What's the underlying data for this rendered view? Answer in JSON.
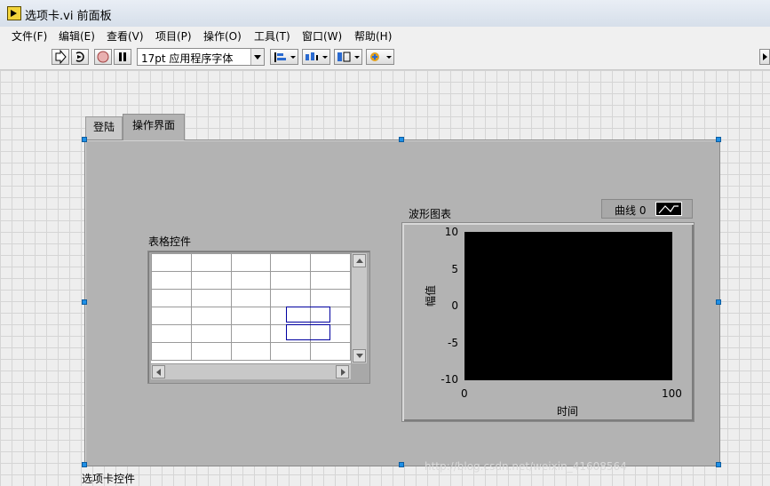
{
  "window": {
    "title": "选项卡.vi 前面板"
  },
  "menu": [
    "文件(F)",
    "编辑(E)",
    "查看(V)",
    "项目(P)",
    "操作(O)",
    "工具(T)",
    "窗口(W)",
    "帮助(H)"
  ],
  "toolbar": {
    "icons": [
      "run-arrow-icon",
      "run-continuously-icon",
      "abort-icon",
      "pause-icon",
      "align-objects-icon",
      "distribute-objects-icon",
      "resize-objects-icon",
      "reorder-icon"
    ],
    "font": "17pt 应用程序字体"
  },
  "tab_control": {
    "label": "选项卡控件",
    "tabs": [
      "登陆",
      "操作界面"
    ],
    "active_tab": "操作界面"
  },
  "table": {
    "label": "表格控件",
    "rows": 6,
    "columns": 5
  },
  "chart": {
    "label": "波形图表",
    "legend_label": "曲线 0",
    "xlabel": "时间",
    "ylabel": "幅值",
    "yticks": [
      "10",
      "5",
      "0",
      "-5",
      "-10"
    ],
    "xticks": [
      "0",
      "100"
    ],
    "plot_background": "#000000"
  },
  "colors": {
    "grid": "#eeeeee",
    "panel": "#b3b3b3",
    "selection": "#0000a0",
    "handles": "#1e8fe6"
  },
  "watermark": "http://blog.csdn.net/weixin_41608564"
}
